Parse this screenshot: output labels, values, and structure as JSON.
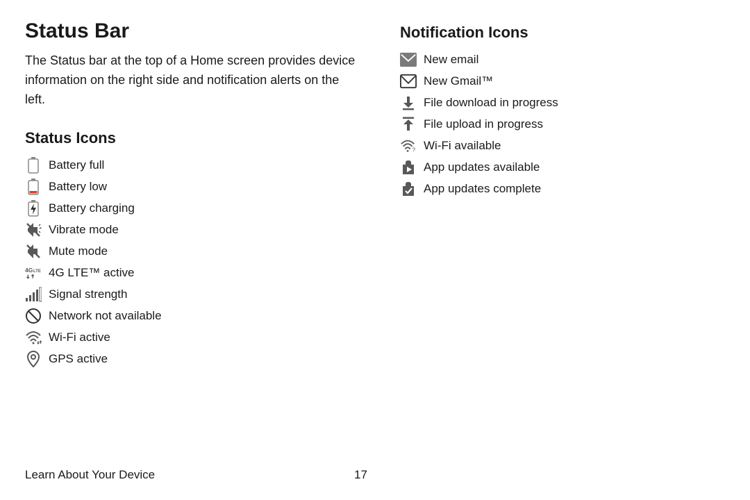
{
  "page_title": "Status Bar",
  "intro_text": "The Status bar at the top of a Home screen provides device information on the right side and notification alerts on the left.",
  "status_icons_heading": "Status Icons",
  "notification_icons_heading": "Notification Icons",
  "status_icons": [
    {
      "icon": "battery-full-icon",
      "label": "Battery full"
    },
    {
      "icon": "battery-low-icon",
      "label": "Battery low"
    },
    {
      "icon": "battery-charging-icon",
      "label": "Battery charging"
    },
    {
      "icon": "vibrate-icon",
      "label": "Vibrate mode"
    },
    {
      "icon": "mute-icon",
      "label": "Mute mode"
    },
    {
      "icon": "4g-lte-icon",
      "label": "4G LTE™ active"
    },
    {
      "icon": "signal-icon",
      "label": "Signal strength"
    },
    {
      "icon": "no-network-icon",
      "label": "Network not available"
    },
    {
      "icon": "wifi-active-icon",
      "label": "Wi-Fi active"
    },
    {
      "icon": "gps-icon",
      "label": "GPS active"
    }
  ],
  "notification_icons": [
    {
      "icon": "email-icon",
      "label": "New email"
    },
    {
      "icon": "gmail-icon",
      "label": "New Gmail™"
    },
    {
      "icon": "download-icon",
      "label": "File download in progress"
    },
    {
      "icon": "upload-icon",
      "label": "File upload in progress"
    },
    {
      "icon": "wifi-available-icon",
      "label": "Wi-Fi available"
    },
    {
      "icon": "app-updates-icon",
      "label": "App updates available"
    },
    {
      "icon": "updates-complete-icon",
      "label": "App updates complete"
    }
  ],
  "footer_text": "Learn About Your Device",
  "page_number": "17"
}
